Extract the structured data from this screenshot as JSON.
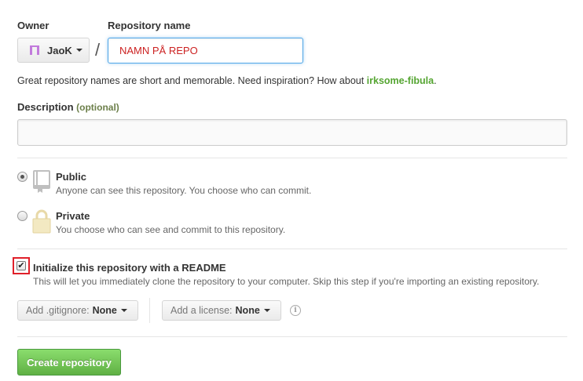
{
  "owner": {
    "label": "Owner",
    "name": "JaoK",
    "avatar_icon": "identicon-icon",
    "avatar_color": "#c27bdc"
  },
  "separator": "/",
  "repository": {
    "label": "Repository name",
    "value": "NAMN PÅ REPO",
    "value_color": "#cc2222"
  },
  "hint": {
    "prefix": "Great repository names are short and memorable. Need inspiration? How about ",
    "suggestion": "irksome-fibula",
    "suffix": "."
  },
  "description": {
    "label": "Description",
    "optional": "(optional)",
    "value": ""
  },
  "visibility": {
    "public": {
      "title": "Public",
      "desc": "Anyone can see this repository. You choose who can commit.",
      "icon": "repo-book-icon",
      "checked": true
    },
    "private": {
      "title": "Private",
      "desc": "You choose who can see and commit to this repository.",
      "icon": "lock-icon",
      "checked": false
    }
  },
  "readme": {
    "title": "Initialize this repository with a README",
    "desc": "This will let you immediately clone the repository to your computer. Skip this step if you're importing an existing repository.",
    "checked": true
  },
  "gitignore": {
    "label": "Add .gitignore:",
    "value": "None"
  },
  "license": {
    "label": "Add a license:",
    "value": "None"
  },
  "info_glyph": "i",
  "create_button": "Create repository",
  "colors": {
    "accent_blue": "#51a7e8",
    "green": "#60b044",
    "suggestion_green": "#55a532",
    "highlight_red": "#e0202a"
  }
}
